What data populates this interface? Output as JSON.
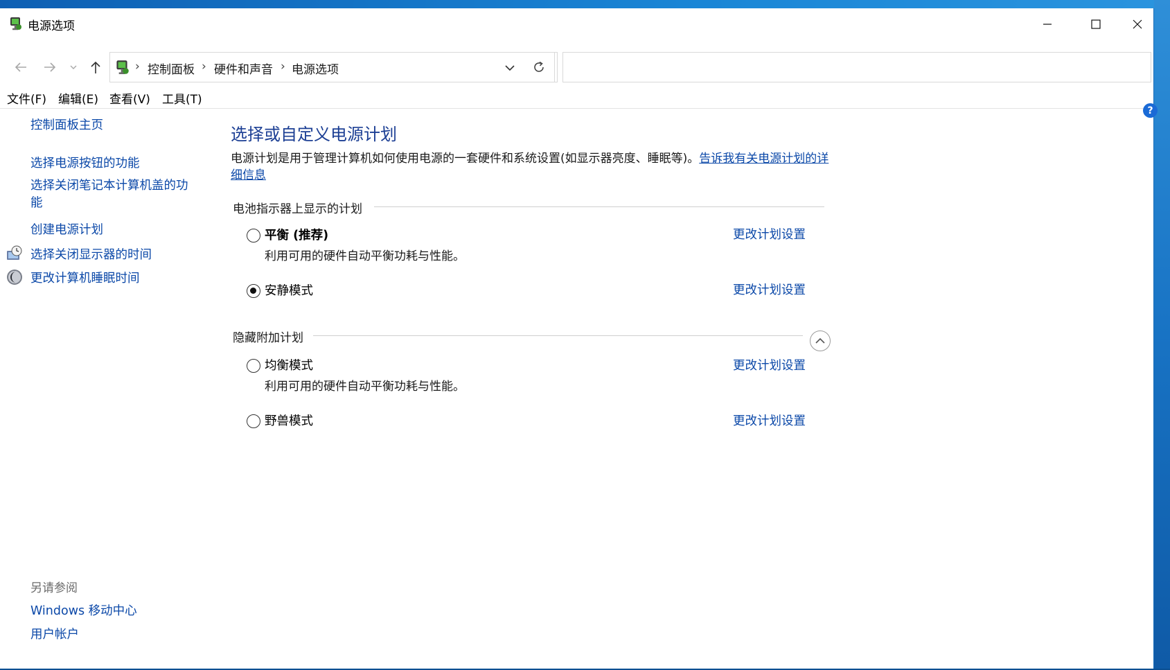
{
  "window": {
    "title": "电源选项",
    "icon": "power-options-icon"
  },
  "titlebar_buttons": {
    "minimize": "minimize-icon",
    "maximize": "maximize-icon",
    "close": "close-icon"
  },
  "address": {
    "crumbs": [
      "控制面板",
      "硬件和声音",
      "电源选项"
    ],
    "separator": "›",
    "search_value": ""
  },
  "menu": [
    "文件(F)",
    "编辑(E)",
    "查看(V)",
    "工具(T)"
  ],
  "help": "?",
  "sidebar": {
    "home": "控制面板主页",
    "links": [
      {
        "label": "选择电源按钮的功能",
        "icon": ""
      },
      {
        "label": "选择关闭笔记本计算机盖的功能",
        "icon": ""
      },
      {
        "label": "创建电源计划",
        "icon": ""
      },
      {
        "label": "选择关闭显示器的时间",
        "icon": "monitor-clock-icon"
      },
      {
        "label": "更改计算机睡眠时间",
        "icon": "moon-icon"
      }
    ],
    "see_also_title": "另请参阅",
    "see_also": [
      "Windows 移动中心",
      "用户帐户"
    ]
  },
  "main": {
    "title": "选择或自定义电源计划",
    "description": "电源计划是用于管理计算机如何使用电源的一套硬件和系统设置(如显示器亮度、睡眠等)。",
    "description_link": "告诉我有关电源计划的详细信息",
    "group_battery": "电池指示器上显示的计划",
    "group_hidden": "隐藏附加计划",
    "plans": [
      {
        "name": "平衡 (推荐)",
        "desc": "利用可用的硬件自动平衡功耗与性能。",
        "selected": false,
        "link": "更改计划设置"
      },
      {
        "name": "安静模式",
        "desc": "",
        "selected": true,
        "link": "更改计划设置"
      },
      {
        "name": "均衡模式",
        "desc": "利用可用的硬件自动平衡功耗与性能。",
        "selected": false,
        "link": "更改计划设置"
      },
      {
        "name": "野兽模式",
        "desc": "",
        "selected": false,
        "link": "更改计划设置"
      }
    ]
  },
  "colors": {
    "link": "#0b48a8",
    "title": "#1c3f94",
    "desktop": "#1877c9"
  }
}
